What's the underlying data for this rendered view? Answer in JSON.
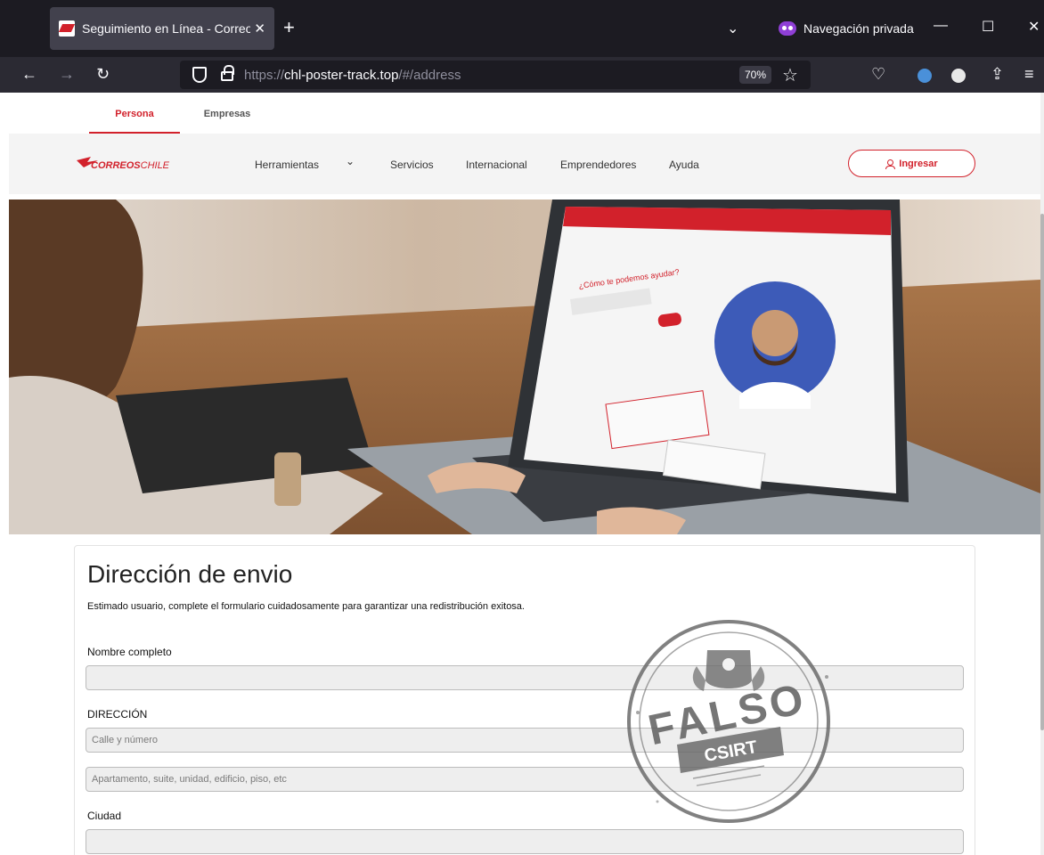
{
  "browser": {
    "tab_title": "Seguimiento en Línea - Correos",
    "tab_close": "✕",
    "new_tab": "+",
    "tab_list": "⌄",
    "private_label": "Navegación privada",
    "minimize": "—",
    "maximize": "☐",
    "close": "✕",
    "back": "←",
    "forward": "→",
    "reload": "↻",
    "url_prefix": "https://",
    "url_host": "chl-poster-track.top",
    "url_path": "/#/address",
    "zoom": "70%",
    "bookmark": "☆",
    "pocket": "♡",
    "share": "⇪",
    "menu": "≡",
    "icons": [
      "shield-icon",
      "lock-icon",
      "pocket-icon",
      "extension-icon",
      "ip-extension-icon",
      "share-icon",
      "menu-icon"
    ]
  },
  "segment": {
    "persona": "Persona",
    "empresas": "Empresas"
  },
  "nav": {
    "items": [
      "Herramientas",
      "Servicios",
      "Internacional",
      "Emprendedores",
      "Ayuda"
    ],
    "dropdown": "⌄",
    "login": "Ingresar",
    "logo_text": "CORREOSCHILE"
  },
  "hero": {
    "laptop_screen_heading": "¿Cómo te podemos ayudar?"
  },
  "form": {
    "title": "Dirección de envio",
    "subtitle": "Estimado usuario, complete el formulario cuidadosamente para garantizar una redistribución exitosa.",
    "name_label": "Nombre completo",
    "name_value": "",
    "address_label": "DIRECCIÓN",
    "street_placeholder": "Calle y número",
    "street_value": "",
    "apt_placeholder": "Apartamento, suite, unidad, edificio, piso, etc",
    "apt_value": "",
    "city_label": "Ciudad",
    "city_value": ""
  },
  "stamp": {
    "main": "FALSO",
    "sub": "CSIRT"
  },
  "colors": {
    "brand_red": "#d2212b",
    "chrome_dark": "#1c1b22",
    "chrome_toolbar": "#2b2a33",
    "private_purple": "#8f3fd6",
    "stamp_gray": "#6b6b6b"
  }
}
